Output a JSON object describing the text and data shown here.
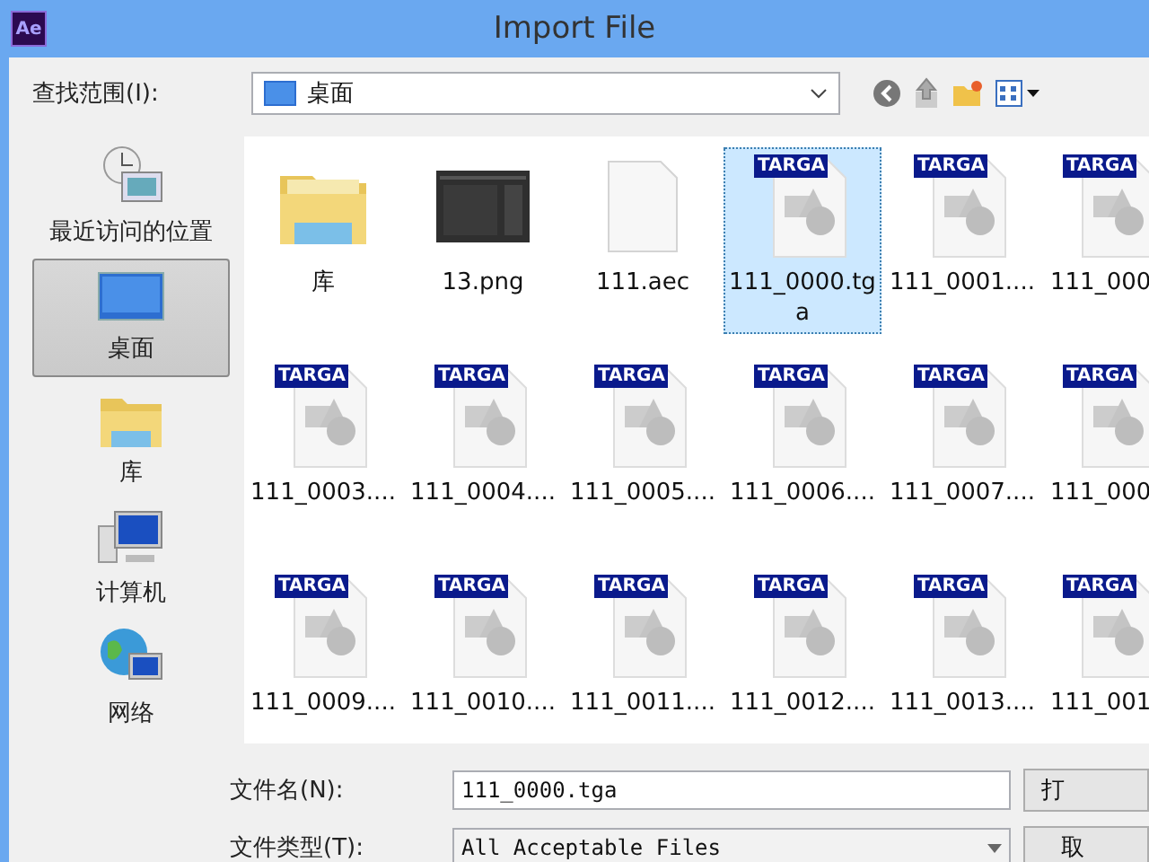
{
  "window": {
    "title": "Import File",
    "app_logo": "Ae"
  },
  "look_in": {
    "label": "查找范围(I):",
    "value": "桌面"
  },
  "sidebar": {
    "items": [
      {
        "label": "最近访问的位置",
        "kind": "recent",
        "selected": false
      },
      {
        "label": "桌面",
        "kind": "desktop",
        "selected": true
      },
      {
        "label": "库",
        "kind": "library",
        "selected": false
      },
      {
        "label": "计算机",
        "kind": "computer",
        "selected": false
      },
      {
        "label": "网络",
        "kind": "network",
        "selected": false
      }
    ]
  },
  "files": [
    {
      "name": "库",
      "kind": "folder",
      "selected": false
    },
    {
      "name": "13.png",
      "kind": "image",
      "selected": false
    },
    {
      "name": "111.aec",
      "kind": "file",
      "selected": false
    },
    {
      "name": "111_0000.tga",
      "kind": "targa",
      "badge": "TARGA",
      "selected": true
    },
    {
      "name": "111_0001....",
      "kind": "targa",
      "badge": "TARGA",
      "selected": false
    },
    {
      "name": "111_000",
      "kind": "targa",
      "badge": "TARGA",
      "selected": false
    },
    {
      "name": "111_0003....",
      "kind": "targa",
      "badge": "TARGA",
      "selected": false
    },
    {
      "name": "111_0004....",
      "kind": "targa",
      "badge": "TARGA",
      "selected": false
    },
    {
      "name": "111_0005....",
      "kind": "targa",
      "badge": "TARGA",
      "selected": false
    },
    {
      "name": "111_0006....",
      "kind": "targa",
      "badge": "TARGA",
      "selected": false
    },
    {
      "name": "111_0007....",
      "kind": "targa",
      "badge": "TARGA",
      "selected": false
    },
    {
      "name": "111_000",
      "kind": "targa",
      "badge": "TARGA",
      "selected": false
    },
    {
      "name": "111_0009....",
      "kind": "targa",
      "badge": "TARGA",
      "selected": false
    },
    {
      "name": "111_0010....",
      "kind": "targa",
      "badge": "TARGA",
      "selected": false
    },
    {
      "name": "111_0011....",
      "kind": "targa",
      "badge": "TARGA",
      "selected": false
    },
    {
      "name": "111_0012....",
      "kind": "targa",
      "badge": "TARGA",
      "selected": false
    },
    {
      "name": "111_0013....",
      "kind": "targa",
      "badge": "TARGA",
      "selected": false
    },
    {
      "name": "111_001",
      "kind": "targa",
      "badge": "TARGA",
      "selected": false
    }
  ],
  "file_name": {
    "label": "文件名(N):",
    "value": "111_0000.tga"
  },
  "file_type": {
    "label": "文件类型(T):",
    "value": "All Acceptable Files"
  },
  "buttons": [
    "打",
    "取"
  ]
}
